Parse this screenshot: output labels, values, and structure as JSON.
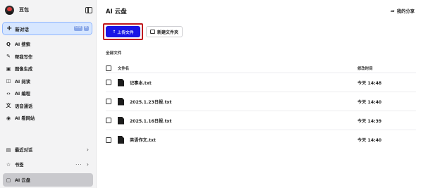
{
  "sidebar": {
    "username": "豆包",
    "new_chat_label": "新对话",
    "new_chat_shortcut": [
      "Ctrl",
      "K"
    ],
    "nav": [
      {
        "icon": "search-icon",
        "glyph": "Q",
        "label": "AI 搜索"
      },
      {
        "icon": "pen-icon",
        "glyph": "✎",
        "label": "帮我写作"
      },
      {
        "icon": "image-icon",
        "glyph": "▣",
        "label": "图像生成"
      },
      {
        "icon": "book-icon",
        "glyph": "◫",
        "label": "AI 阅读"
      },
      {
        "icon": "code-icon",
        "glyph": "‹›",
        "label": "AI 编程"
      },
      {
        "icon": "translate-icon",
        "glyph": "文",
        "label": "语音通话"
      },
      {
        "icon": "globe-icon",
        "glyph": "◉",
        "label": "AI 看网站"
      }
    ],
    "recent_label": "最近对话",
    "bookmarks_label": "书签",
    "bookmarks_more": "···",
    "cloud_label": "AI 云盘"
  },
  "header": {
    "title": "AI 云盘",
    "share_label": "我的分享"
  },
  "toolbar": {
    "upload_label": "上传文件",
    "new_folder_label": "新建文件夹"
  },
  "files": {
    "section_label": "全部文件",
    "col_name": "文件名",
    "col_time": "修改时间",
    "rows": [
      {
        "name": "记事本.txt",
        "time": "今天 14:48"
      },
      {
        "name": "2025.1.23日报.txt",
        "time": "今天 14:40"
      },
      {
        "name": "2025.1.16日报.txt",
        "time": "今天 14:39"
      },
      {
        "name": "英语作文.txt",
        "time": "今天 14:40"
      }
    ]
  },
  "colors": {
    "upload_button": "#1a14e6",
    "highlight_border": "#c0191f",
    "sidebar_bg": "#f3f3f4",
    "active_item": "#c9c9cd"
  }
}
